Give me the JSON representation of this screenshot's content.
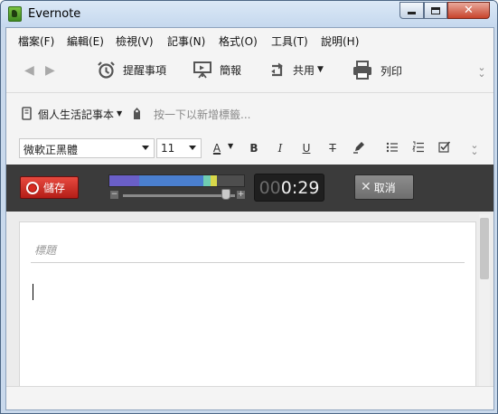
{
  "window": {
    "title": "Evernote"
  },
  "menu": [
    "檔案(F)",
    "編輯(E)",
    "檢視(V)",
    "記事(N)",
    "格式(O)",
    "工具(T)",
    "說明(H)"
  ],
  "toolbar": {
    "reminder_label": "提醒事項",
    "present_label": "簡報",
    "share_label": "共用",
    "print_label": "列印"
  },
  "note_bar": {
    "notebook": "個人生活記事本",
    "tag_placeholder": "按一下以新增標籤..."
  },
  "format": {
    "font": "微軟正黑體",
    "size": "11",
    "font_color_label": "A",
    "bold": "B",
    "italic": "I",
    "underline": "U",
    "strike": "T"
  },
  "recorder": {
    "save_label": "儲存",
    "timer_dim": "00",
    "timer_main": "0:29",
    "cancel_label": "取消",
    "level": 0.62
  },
  "editor": {
    "title_placeholder": "標題"
  },
  "colors": {
    "record": "#d72a20",
    "recbar": "#3b3b3b",
    "meter_blue": "#4a7fcf",
    "meter_yellow": "#d8d84a"
  }
}
